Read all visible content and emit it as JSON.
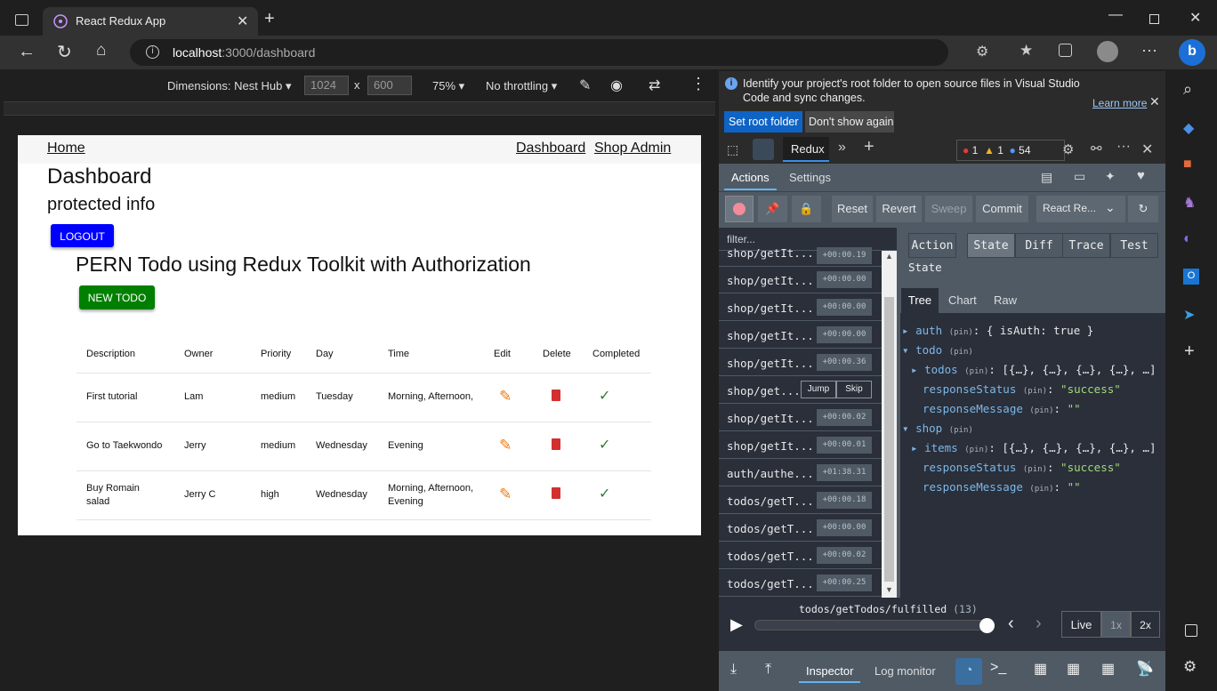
{
  "browser": {
    "tab_title": "React Redux App",
    "url_host": "localhost",
    "url_path": ":3000/dashboard"
  },
  "device_toolbar": {
    "dimensions_label": "Dimensions: Nest Hub",
    "width": "1024",
    "times": "x",
    "height": "600",
    "zoom": "75%",
    "throttling": "No throttling"
  },
  "app": {
    "nav_home": "Home",
    "nav_dashboard": "Dashboard",
    "nav_shop_admin": "Shop Admin",
    "heading": "Dashboard",
    "subheading": "protected info",
    "logout": "LOGOUT",
    "todo_title": "PERN Todo using Redux Toolkit with Authorization",
    "new_todo": "NEW TODO",
    "columns": [
      "Description",
      "Owner",
      "Priority",
      "Day",
      "Time",
      "Edit",
      "Delete",
      "Completed"
    ],
    "rows": [
      {
        "description": "First tutorial",
        "owner": "Lam",
        "priority": "medium",
        "day": "Tuesday",
        "time": "Morning, Afternoon,"
      },
      {
        "description": "Go to Taekwondo",
        "owner": "Jerry",
        "priority": "medium",
        "day": "Wednesday",
        "time": "Evening"
      },
      {
        "description": "Buy Romain salad",
        "owner": "Jerry C",
        "priority": "high",
        "day": "Wednesday",
        "time": "Morning, Afternoon, Evening"
      }
    ]
  },
  "devtools": {
    "info_message": "Identify your project's root folder to open source files in Visual Studio Code and sync changes.",
    "learn_more": "Learn more",
    "set_root": "Set root folder",
    "dont_show": "Don't show again",
    "active_tab": "Redux",
    "errors": "1",
    "warnings": "1",
    "messages": "54",
    "redux": {
      "tab_actions": "Actions",
      "tab_settings": "Settings",
      "reset": "Reset",
      "revert": "Revert",
      "sweep": "Sweep",
      "commit": "Commit",
      "instance": "React Re...",
      "filter_placeholder": "filter...",
      "actions": [
        {
          "name": "shop/getIt...",
          "time": "+00:00.19"
        },
        {
          "name": "shop/getIt...",
          "time": "+00:00.00"
        },
        {
          "name": "shop/getIt...",
          "time": "+00:00.00"
        },
        {
          "name": "shop/getIt...",
          "time": "+00:00.00"
        },
        {
          "name": "shop/getIt...",
          "time": "+00:00.36"
        },
        {
          "name": "shop/get...",
          "time": ""
        },
        {
          "name": "shop/getIt...",
          "time": "+00:00.02"
        },
        {
          "name": "shop/getIt...",
          "time": "+00:00.01"
        },
        {
          "name": "auth/authe...",
          "time": "+01:38.31"
        },
        {
          "name": "todos/getT...",
          "time": "+00:00.18"
        },
        {
          "name": "todos/getT...",
          "time": "+00:00.00"
        },
        {
          "name": "todos/getT...",
          "time": "+00:00.02"
        },
        {
          "name": "todos/getT...",
          "time": "+00:00.25"
        }
      ],
      "jump": "Jump",
      "skip": "Skip",
      "view_tabs": [
        "Action",
        "State",
        "Diff",
        "Trace",
        "Test"
      ],
      "state_label": "State",
      "tree_tabs": [
        "Tree",
        "Chart",
        "Raw"
      ],
      "tree": {
        "auth_key": "auth",
        "auth_val": "{ isAuth: true }",
        "todo_key": "todo",
        "todos_key": "todos",
        "todos_val": "[{…}, {…}, {…}, {…}, …]",
        "status_key": "responseStatus",
        "status_val": "\"success\"",
        "message_key": "responseMessage",
        "message_val": "\"\"",
        "shop_key": "shop",
        "items_key": "items",
        "items_val": "[{…}, {…}, {…}, {…}, …]",
        "pin": "(pin)"
      },
      "current_action": "todos/getTodos/fulfilled",
      "current_index": "(13)",
      "speed_live": "Live",
      "speed_1x": "1x",
      "speed_2x": "2x",
      "bottom_inspector": "Inspector",
      "bottom_log": "Log monitor"
    }
  }
}
